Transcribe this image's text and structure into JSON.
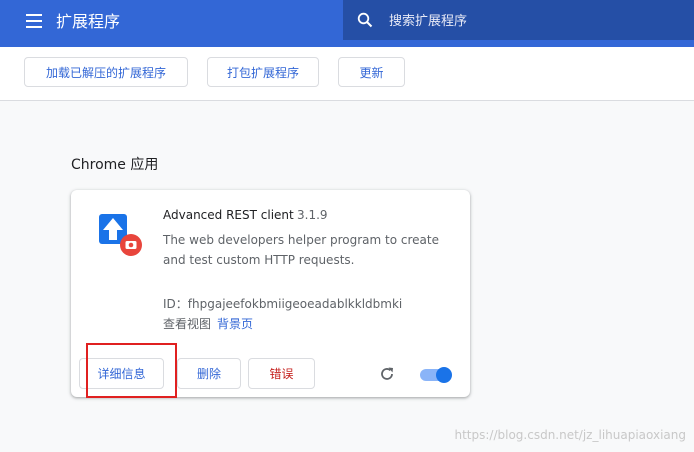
{
  "header": {
    "title": "扩展程序",
    "search_placeholder": "搜索扩展程序",
    "color": "#3367d6"
  },
  "toolbar": {
    "load_unpacked_label": "加载已解压的扩展程序",
    "pack_label": "打包扩展程序",
    "update_label": "更新"
  },
  "section": {
    "title": "Chrome 应用"
  },
  "extension": {
    "name": "Advanced REST client",
    "version": "3.1.9",
    "description": "The web developers helper program to create and test custom HTTP requests.",
    "id_label": "ID：",
    "id_value": "fhpgajeefokbmiigeoeadablkkldbmki",
    "inspect_label": "查看视图",
    "inspect_link": "背景页",
    "details_label": "详细信息",
    "remove_label": "删除",
    "errors_label": "错误",
    "enabled": true,
    "icons": [
      "app-arrow-icon",
      "reload-icon",
      "toggle-switch"
    ]
  },
  "watermark": "https://blog.csdn.net/jz_lihuapiaoxiang"
}
